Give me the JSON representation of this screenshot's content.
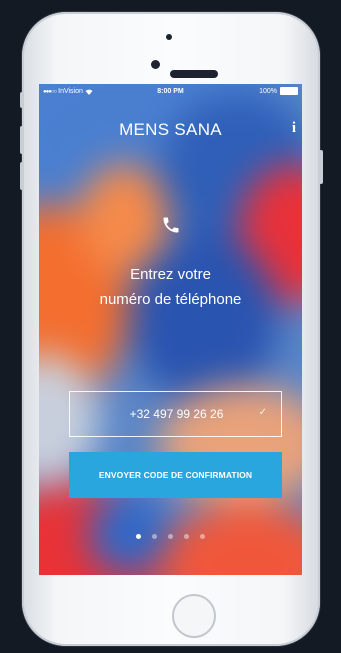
{
  "status_bar": {
    "carrier": "InVision",
    "time": "8:00 PM",
    "battery": "100%"
  },
  "header": {
    "title": "MENS SANA",
    "info_icon": "i"
  },
  "onboarding": {
    "icon": "phone-icon",
    "prompt_line1": "Entrez votre",
    "prompt_line2": "numéro de téléphone",
    "phone_value": "+32 497 99 26 26",
    "check_icon": "✓",
    "send_button": "ENVOYER CODE DE CONFIRMATION",
    "pager": {
      "total": 5,
      "active_index": 0
    }
  },
  "colors": {
    "accent": "#2aa6df",
    "background_orange": "#f2733a",
    "background_blue": "#3c6fc8",
    "background_red": "#e8363a"
  }
}
